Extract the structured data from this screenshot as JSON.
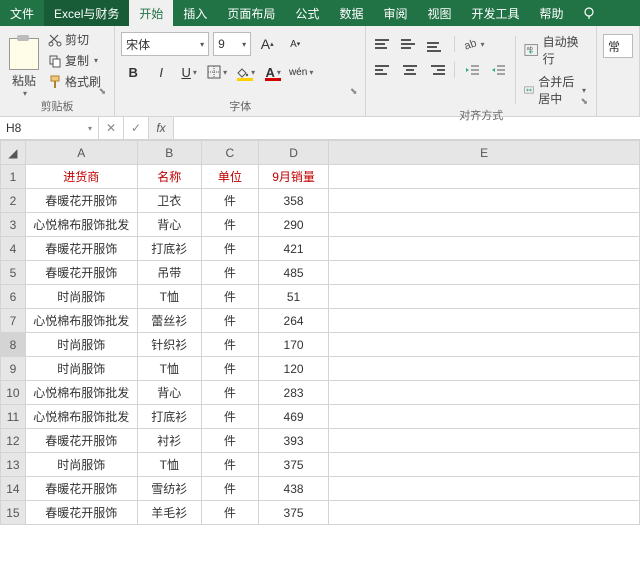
{
  "menu": {
    "file": "文件",
    "account": "Excel与财务",
    "start": "开始",
    "insert": "插入",
    "layout": "页面布局",
    "formula": "公式",
    "data": "数据",
    "review": "审阅",
    "view": "视图",
    "dev": "开发工具",
    "help": "帮助"
  },
  "ribbon": {
    "clipboard": {
      "label": "剪贴板",
      "cut": "剪切",
      "copy": "复制",
      "format_painter": "格式刷",
      "paste": "粘贴"
    },
    "font": {
      "label": "字体",
      "name": "宋体",
      "size": "9",
      "wen": "wén"
    },
    "align": {
      "label": "对齐方式",
      "wrap": "自动换行",
      "merge": "合并后居中"
    },
    "general_group": "常"
  },
  "namebox": "H8",
  "sheet": {
    "cols": [
      "A",
      "B",
      "C",
      "D",
      "E"
    ],
    "header": [
      "进货商",
      "名称",
      "单位",
      "9月销量"
    ],
    "rows": [
      [
        "春暖花开服饰",
        "卫衣",
        "件",
        "358"
      ],
      [
        "心悦棉布服饰批发",
        "背心",
        "件",
        "290"
      ],
      [
        "春暖花开服饰",
        "打底衫",
        "件",
        "421"
      ],
      [
        "春暖花开服饰",
        "吊带",
        "件",
        "485"
      ],
      [
        "时尚服饰",
        "T恤",
        "件",
        "51"
      ],
      [
        "心悦棉布服饰批发",
        "蕾丝衫",
        "件",
        "264"
      ],
      [
        "时尚服饰",
        "针织衫",
        "件",
        "170"
      ],
      [
        "时尚服饰",
        "T恤",
        "件",
        "120"
      ],
      [
        "心悦棉布服饰批发",
        "背心",
        "件",
        "283"
      ],
      [
        "心悦棉布服饰批发",
        "打底衫",
        "件",
        "469"
      ],
      [
        "春暖花开服饰",
        "衬衫",
        "件",
        "393"
      ],
      [
        "时尚服饰",
        "T恤",
        "件",
        "375"
      ],
      [
        "春暖花开服饰",
        "雪纺衫",
        "件",
        "438"
      ],
      [
        "春暖花开服饰",
        "羊毛衫",
        "件",
        "375"
      ]
    ],
    "selected_row": 8
  }
}
